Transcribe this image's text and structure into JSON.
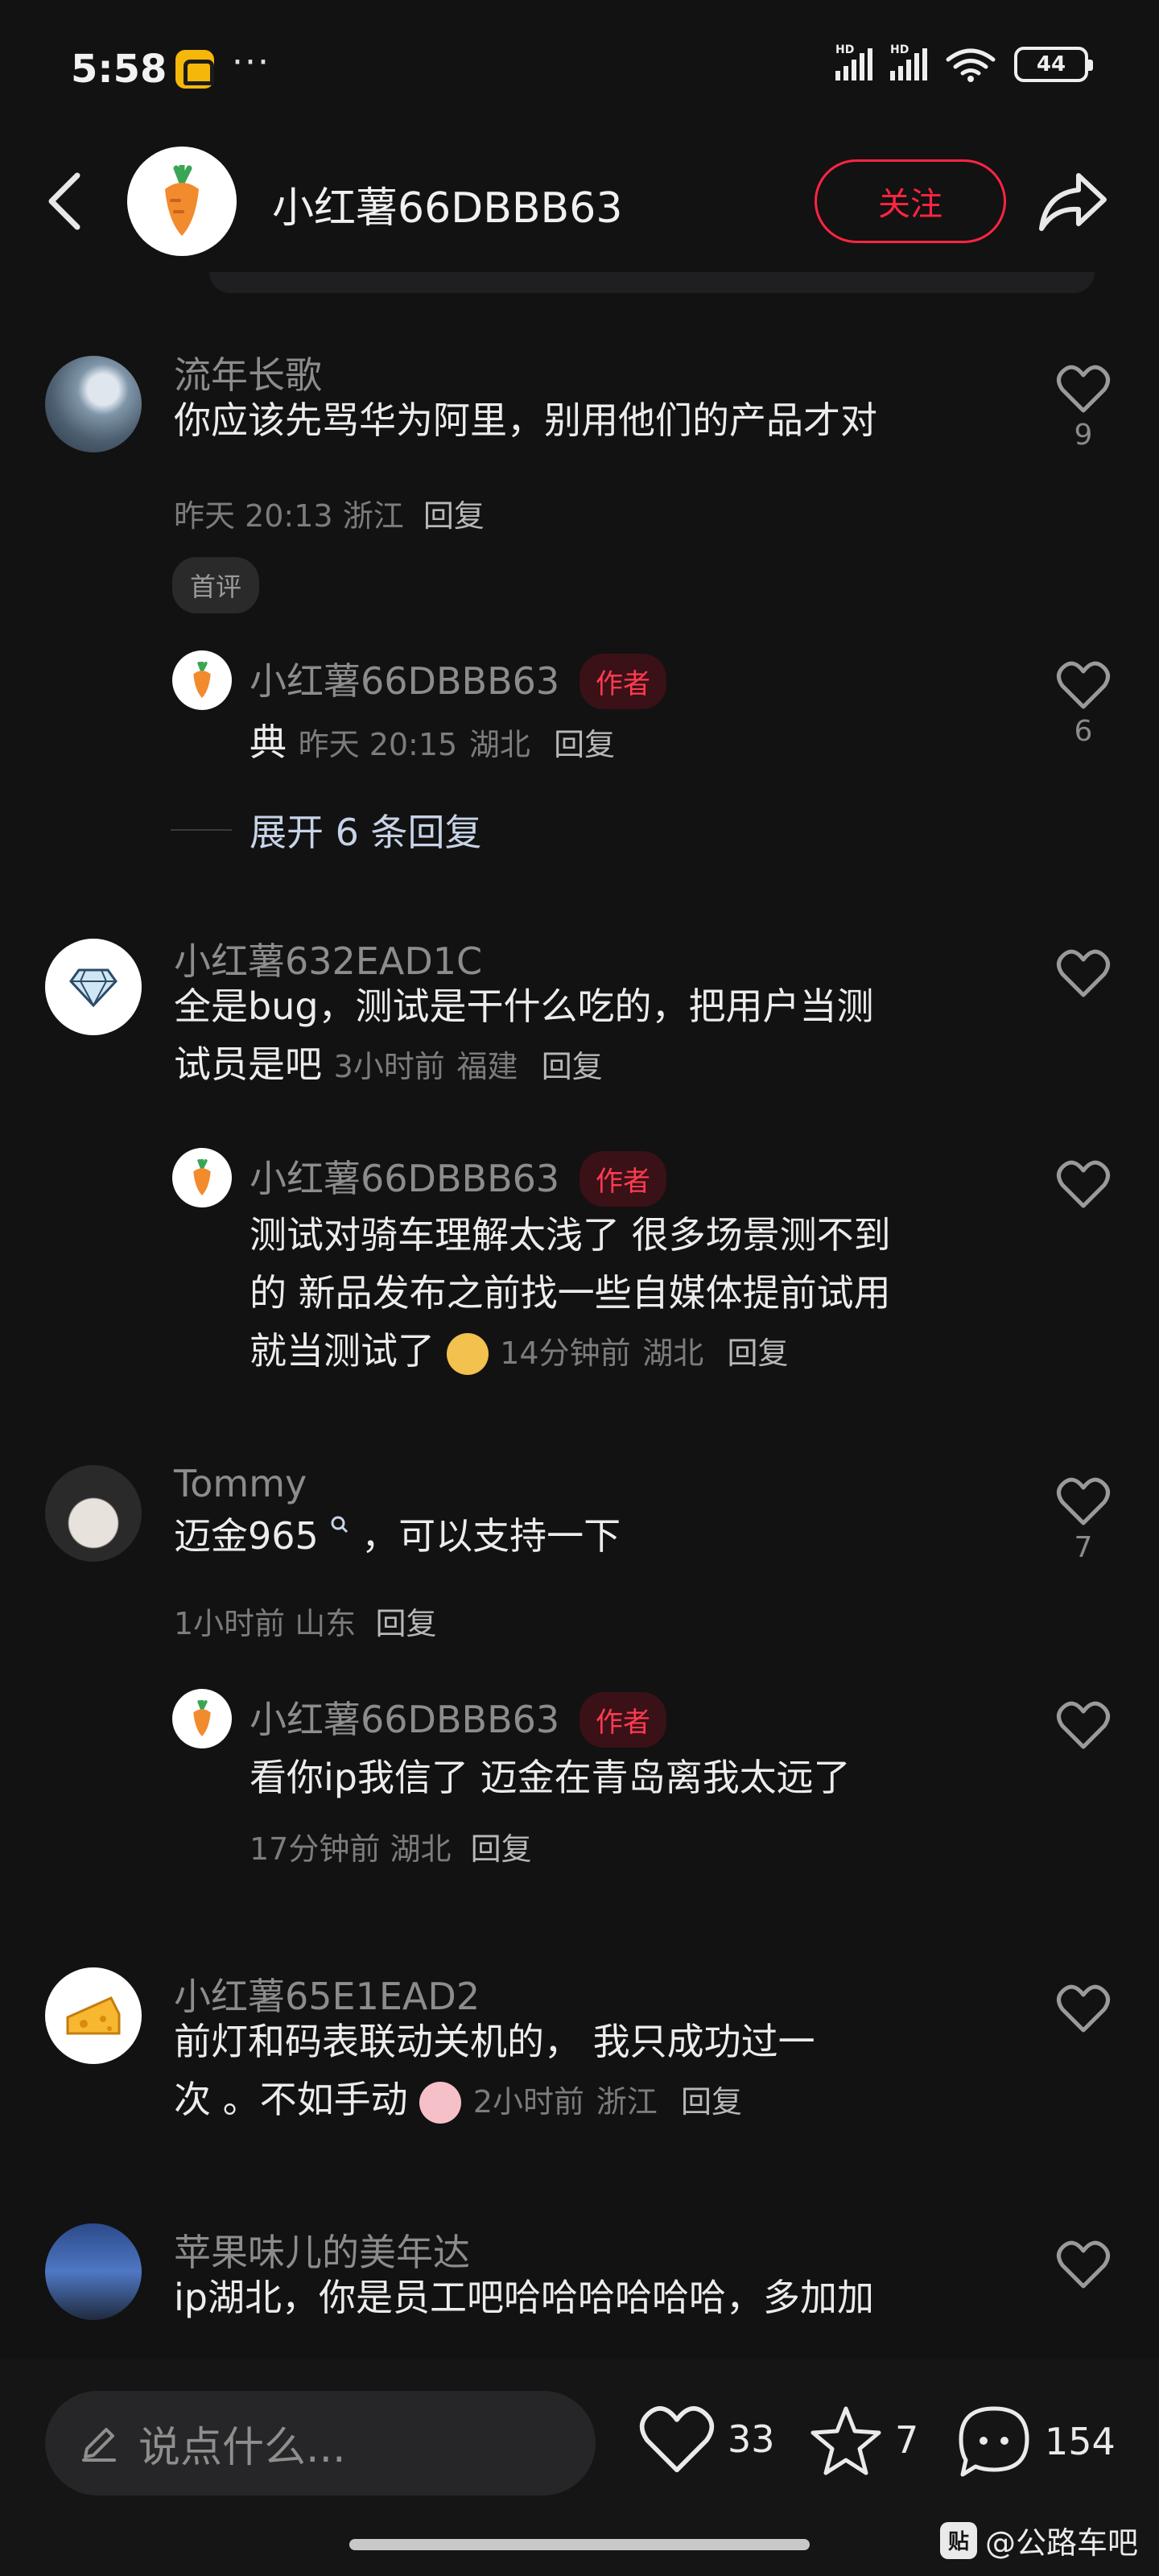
{
  "status_bar": {
    "time": "5:58",
    "battery": "44",
    "network_label": "HD"
  },
  "header": {
    "title": "小红薯66DBBB63",
    "follow_label": "关注"
  },
  "comments": [
    {
      "username": "流年长歌",
      "text": "你应该先骂华为阿里，别用他们的产品才对",
      "time": "昨天 20:13",
      "location": "浙江",
      "reply_label": "回复",
      "tag": "首评",
      "likes": "9",
      "replies": [
        {
          "username": "小红薯66DBBB63",
          "author_tag": "作者",
          "text": "典",
          "time": "昨天 20:15",
          "location": "湖北",
          "reply_label": "回复",
          "likes": "6"
        }
      ],
      "expand_label": "展开 6 条回复"
    },
    {
      "username": "小红薯632EAD1C",
      "text_line1": "全是bug，测试是干什么吃的，把用户当测",
      "text_line2": "试员是吧",
      "time": "3小时前",
      "location": "福建",
      "reply_label": "回复",
      "replies": [
        {
          "username": "小红薯66DBBB63",
          "author_tag": "作者",
          "text_line1": "测试对骑车理解太浅了 很多场景测不到",
          "text_line2": "的 新品发布之前找一些自媒体提前试用",
          "text_line3": "就当测试了",
          "time": "14分钟前",
          "location": "湖北",
          "reply_label": "回复"
        }
      ]
    },
    {
      "username": "Tommy",
      "text": "迈金965",
      "text_suffix": "，可以支持一下",
      "time": "1小时前",
      "location": "山东",
      "reply_label": "回复",
      "likes": "7",
      "replies": [
        {
          "username": "小红薯66DBBB63",
          "author_tag": "作者",
          "text": "看你ip我信了 迈金在青岛离我太远了",
          "time": "17分钟前",
          "location": "湖北",
          "reply_label": "回复"
        }
      ]
    },
    {
      "username": "小红薯65E1EAD2",
      "text_line1": "前灯和码表联动关机的， 我只成功过一",
      "text_line2": "次 。不如手动",
      "time": "2小时前",
      "location": "浙江",
      "reply_label": "回复"
    },
    {
      "username": "苹果味儿的美年达",
      "text_line1": "ip湖北，你是员工吧哈哈哈哈哈哈，多加加"
    }
  ],
  "bottom_bar": {
    "input_placeholder": "说点什么...",
    "likes": "33",
    "stars": "7",
    "comments": "154"
  },
  "watermark": {
    "icon_text": "贴",
    "text": "@公路车吧"
  },
  "colors": {
    "accent": "#ff2442",
    "background": "#121212",
    "author_tag_bg": "#3a1116"
  }
}
